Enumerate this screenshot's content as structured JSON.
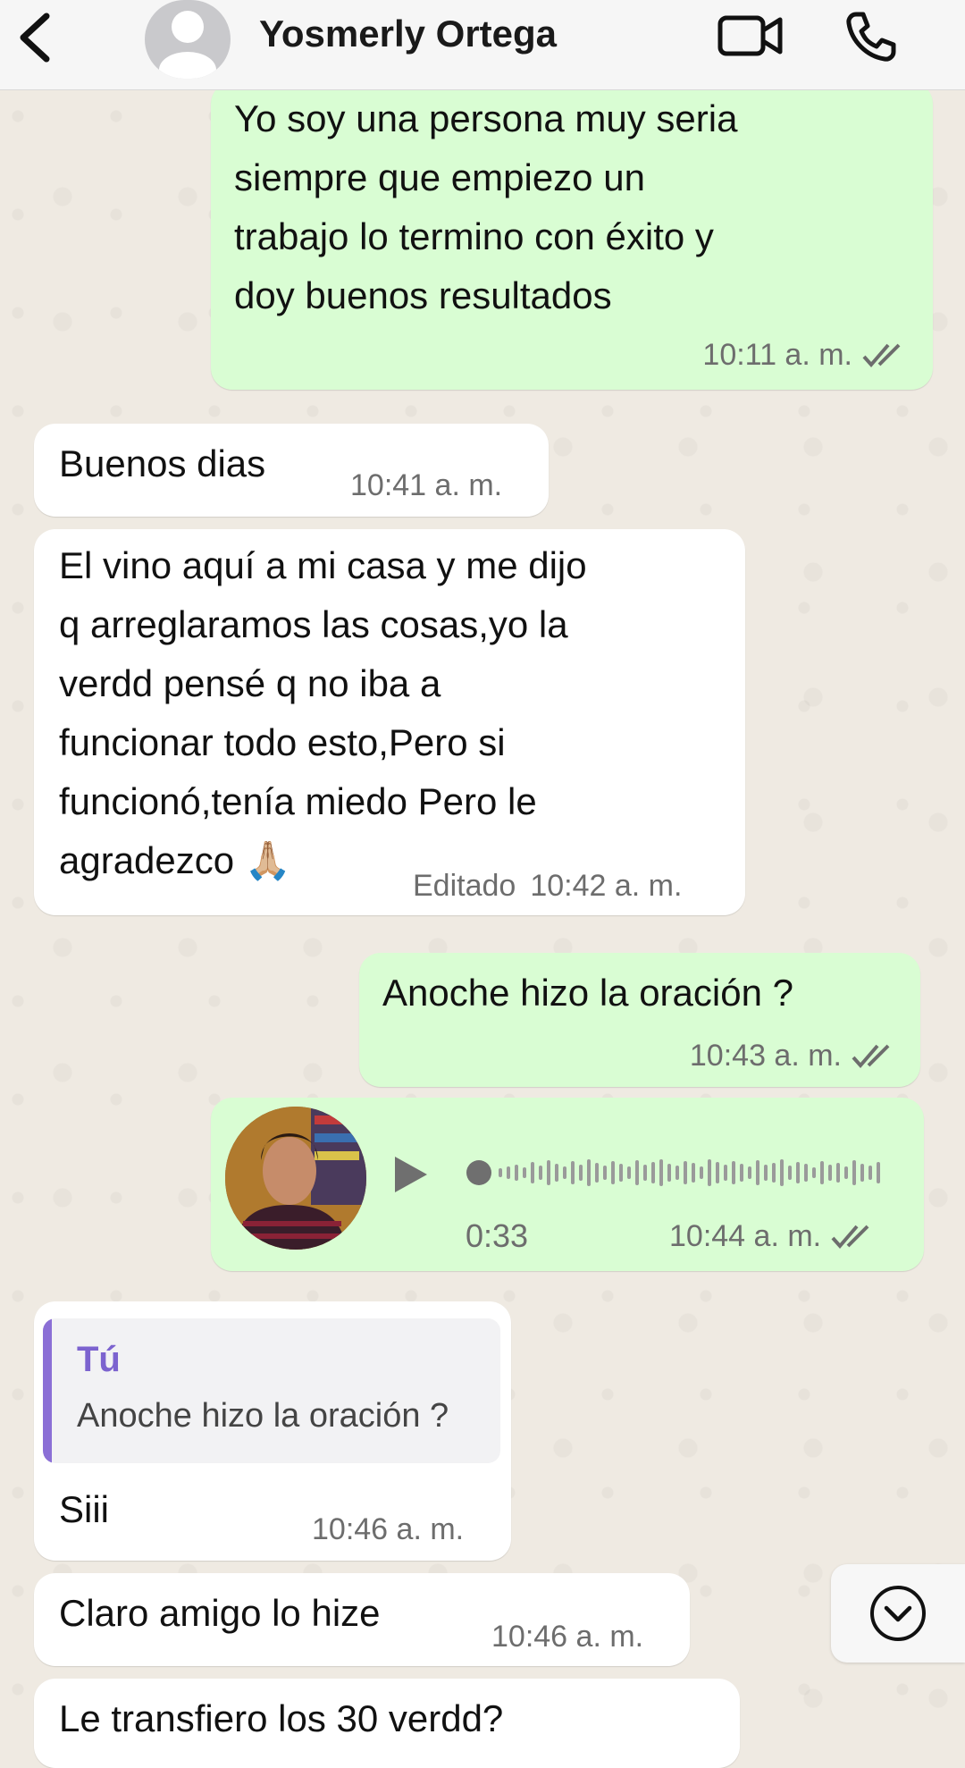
{
  "header": {
    "contact_name": "Yosmerly Ortega",
    "icons": [
      "back-chevron-icon",
      "default-avatar-icon",
      "video-call-icon",
      "phone-call-icon"
    ]
  },
  "messages": [
    {
      "direction": "outgoing",
      "text": "Yo soy una persona muy seria\nsiempre que empiezo un\ntrabajo lo termino con éxito y\ndoy buenos resultados",
      "time": "10:11 a. m.",
      "status": "read"
    },
    {
      "direction": "incoming",
      "text": "Buenos dias",
      "time": "10:41 a. m."
    },
    {
      "direction": "incoming",
      "text": "El vino aquí a mi casa y me dijo\nq arreglaramos las cosas,yo la\nverdd pensé q no iba a\nfuncionar todo esto,Pero si\nfuncionó,tenía miedo Pero le\nagradezco 🙏🏼",
      "edited_label": "Editado",
      "time": "10:42 a. m."
    },
    {
      "direction": "outgoing",
      "text": "Anoche hizo la oración ?",
      "time": "10:43 a. m.",
      "status": "read"
    },
    {
      "direction": "outgoing",
      "type": "voice",
      "duration": "0:33",
      "time": "10:44 a. m.",
      "status": "read"
    },
    {
      "direction": "incoming",
      "reply_to": {
        "author": "Tú",
        "text": "Anoche hizo la oración ?"
      },
      "text": "Siii",
      "time": "10:46 a. m."
    },
    {
      "direction": "incoming",
      "text": "Claro amigo lo hize",
      "time": "10:46 a. m."
    },
    {
      "direction": "incoming",
      "text": "Le transfiero los 30 verdd?",
      "partially_visible": true
    }
  ],
  "colors": {
    "outgoing_bubble": "#d9fdd3",
    "incoming_bubble": "#ffffff",
    "quote_accent": "#8b6fd6",
    "read_tick": "#6d6d6d"
  },
  "scroll_button_icon": "chevron-down-circle-icon"
}
